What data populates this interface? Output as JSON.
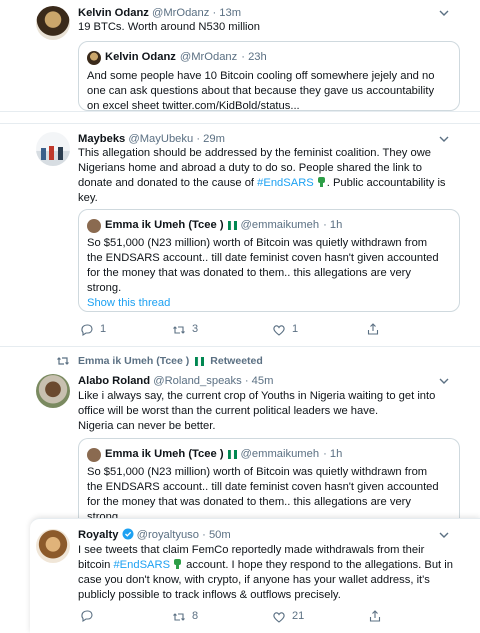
{
  "tweets": [
    {
      "name": "Kelvin Odanz",
      "handle": "@MrOdanz",
      "time": "· 13m",
      "text": "19 BTCs. Worth around N530 million",
      "quote": {
        "name": "Kelvin Odanz",
        "handle": "@MrOdanz",
        "time": "· 23h",
        "line1": "And some people have 10 Bitcoin cooling off somewhere jejely and no",
        "line2": "one can ask questions about that because they gave us accountability",
        "line3": "on excel sheet twitter.com/KidBold/status..."
      }
    },
    {
      "name": "Maybeks",
      "handle": "@MayUbeku",
      "time": "· 29m",
      "line1": "This allegation should be addressed by the feminist coalition. They owe",
      "line2": "Nigerians home and abroad a duty to do so. People shared the link to",
      "line3_pre": "donate and donated to the cause of ",
      "hashtag": "#EndSARS",
      "line3_post": ". Public accountability is",
      "line4": "key.",
      "quote": {
        "name": "Emma ik Umeh (Tcee )",
        "handle": "@emmaikumeh",
        "time": "· 1h",
        "line1": "So $51,000 (N23 million) worth of Bitcoin was quietly withdrawn from",
        "line2": "the ENDSARS account.. till date feminist coven hasn't given accounted",
        "line3": "for the money that was donated to them.. this allegations are very",
        "line4": "strong.",
        "show_thread": "Show this thread"
      },
      "replies": "1",
      "retweets": "3",
      "likes": "1"
    },
    {
      "retweeted_by": "Emma ik Umeh (Tcee )",
      "retweeted_label": "Retweeted",
      "name": "Alabo Roland",
      "handle": "@Roland_speaks",
      "time": "· 45m",
      "line1": "Like i always say, the current crop of Youths in Nigeria waiting to get into",
      "line2": "office will be worst than the current political leaders we have.",
      "line3": "Nigeria can never be better.",
      "quote": {
        "name": "Emma ik Umeh (Tcee )",
        "handle": "@emmaikumeh",
        "time": "· 1h",
        "line1": "So $51,000 (N23 million) worth of Bitcoin was quietly withdrawn from",
        "line2": "the ENDSARS account.. till date feminist coven hasn't given accounted",
        "line3": "for the money that was donated to them.. this allegations are very",
        "line4": "strong."
      }
    },
    {
      "name": "Royalty",
      "handle": "@royaltyuso",
      "time": "· 50m",
      "line1": "I see tweets that claim FemCo reportedly made withdrawals from their",
      "line2_pre": "bitcoin ",
      "hashtag": "#EndSARS",
      "line2_post": " account. I hope they respond to the allegations. But in",
      "line3": "case you don't know, with crypto, if anyone has your wallet address, it's",
      "line4": "publicly possible to track inflows & outflows precisely.",
      "replies": "",
      "retweets": "8",
      "likes": "21"
    }
  ],
  "colors": {
    "accent": "#1da1f2",
    "muted": "#5b7083",
    "border": "#e6ecf0"
  }
}
